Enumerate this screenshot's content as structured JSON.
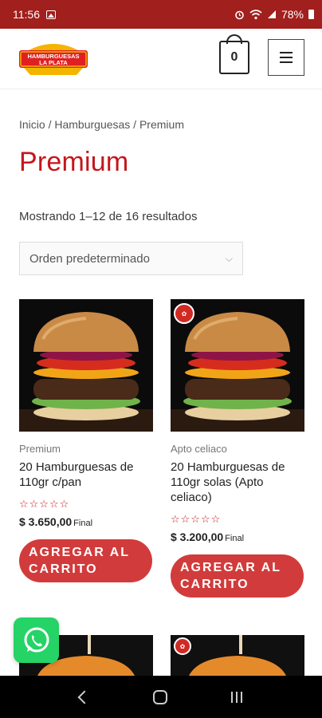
{
  "status_bar": {
    "time": "11:56",
    "battery": "78%"
  },
  "header": {
    "logo_line1": "HAMBURGUESAS",
    "logo_line2": "LA PLATA",
    "cart_count": "0"
  },
  "breadcrumb": {
    "home": "Inicio",
    "sep1": " / ",
    "category": "Hamburguesas",
    "sep2": " / ",
    "current": "Premium"
  },
  "page_title": "Premium",
  "result_count": "Mostrando 1–12 de 16 resultados",
  "orderby": {
    "selected": "Orden predeterminado"
  },
  "products": [
    {
      "category": "Premium",
      "title": "20 Hamburguesas de 110gr c/pan",
      "stars": "☆☆☆☆☆",
      "price": "$ 3.650,00",
      "price_suffix": "Final",
      "button": "Agregar al carrito"
    },
    {
      "category": "Apto celiaco",
      "title": "20 Hamburguesas de 110gr solas (Apto celiaco)",
      "stars": "☆☆☆☆☆",
      "price": "$ 3.200,00",
      "price_suffix": "Final",
      "button": "Agregar al carrito"
    }
  ],
  "colors": {
    "status_bar": "#a11f1c",
    "title": "#c4161c",
    "button": "#d23b3b",
    "whatsapp": "#25d366"
  },
  "icons": [
    "image-icon",
    "alarm-icon",
    "wifi-icon",
    "signal-icon",
    "battery-icon",
    "cart-icon",
    "menu-icon",
    "whatsapp-icon",
    "back-icon",
    "home-icon",
    "recent-apps-icon"
  ]
}
